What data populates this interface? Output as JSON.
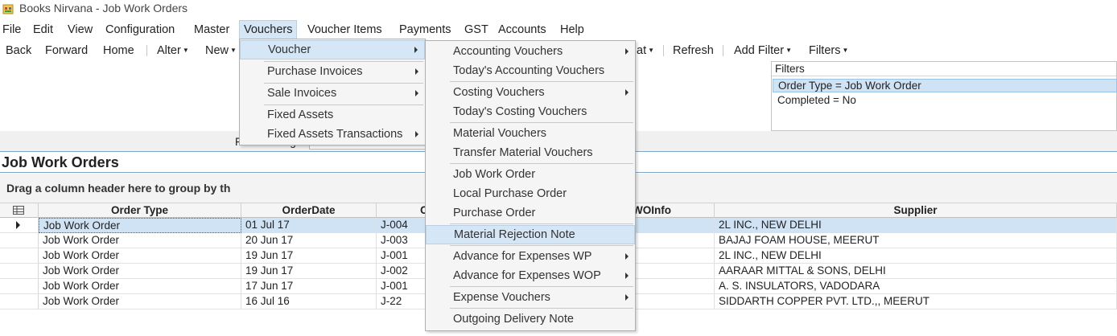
{
  "window": {
    "title": "Books Nirvana - Job Work Orders",
    "icon": "app-icon"
  },
  "menubar": [
    "File",
    "Edit",
    "View",
    "Configuration",
    "Master",
    "Vouchers",
    "Voucher Items",
    "Payments",
    "GST",
    "Accounts",
    "Help"
  ],
  "toolbar": {
    "back": "Back",
    "forward": "Forward",
    "home": "Home",
    "alter": "Alter",
    "new": "New",
    "format_fragment": "at",
    "refresh": "Refresh",
    "add_filter": "Add Filter",
    "filters": "Filters"
  },
  "filters_panel": {
    "title": "Filters",
    "rows": [
      "Order Type = Job Work Order",
      "Completed = No"
    ]
  },
  "find": {
    "label": "Find On Page"
  },
  "grid": {
    "title": "Job Work Orders",
    "group_hint": "Drag a column header here to group by th",
    "columns": [
      "Order Type",
      "OrderDate",
      "O",
      "WOInfo",
      "Supplier"
    ],
    "rows": [
      {
        "order_type": "Job Work Order",
        "order_date": "01 Jul 17",
        "order_no": "J-004",
        "supplier": "2L INC., NEW DELHI"
      },
      {
        "order_type": "Job Work Order",
        "order_date": "20 Jun 17",
        "order_no": "J-003",
        "supplier": "BAJAJ FOAM HOUSE, MEERUT"
      },
      {
        "order_type": "Job Work Order",
        "order_date": "19 Jun 17",
        "order_no": "J-001",
        "supplier": "2L INC., NEW DELHI"
      },
      {
        "order_type": "Job Work Order",
        "order_date": "19 Jun 17",
        "order_no": "J-002",
        "supplier": "AARAAR MITTAL & SONS, DELHI"
      },
      {
        "order_type": "Job Work Order",
        "order_date": "17 Jun 17",
        "order_no": "J-001",
        "supplier": "A. S. INSULATORS, VADODARA"
      },
      {
        "order_type": "Job Work Order",
        "order_date": "16 Jul 16",
        "order_no": "J-22",
        "supplier": "SIDDARTH COPPER PVT. LTD.,, MEERUT"
      }
    ]
  },
  "vouchers_menu": [
    "Voucher",
    "Purchase Invoices",
    "Sale Invoices",
    "Fixed Assets",
    "Fixed Assets Transactions"
  ],
  "voucher_submenu": [
    "Accounting Vouchers",
    "Today's Accounting Vouchers",
    "Costing Vouchers",
    "Today's Costing Vouchers",
    "Material Vouchers",
    "Transfer Material Vouchers",
    "Job Work Order",
    "Local Purchase Order",
    "Purchase Order",
    "Material Rejection Note",
    "Advance for Expenses WP",
    "Advance for Expenses WOP",
    "Expense Vouchers",
    "Outgoing Delivery Note"
  ],
  "colors": {
    "highlight": "#d5e6f7",
    "selected_row": "#cfe3f5",
    "accent_line": "#7fa4c8"
  }
}
